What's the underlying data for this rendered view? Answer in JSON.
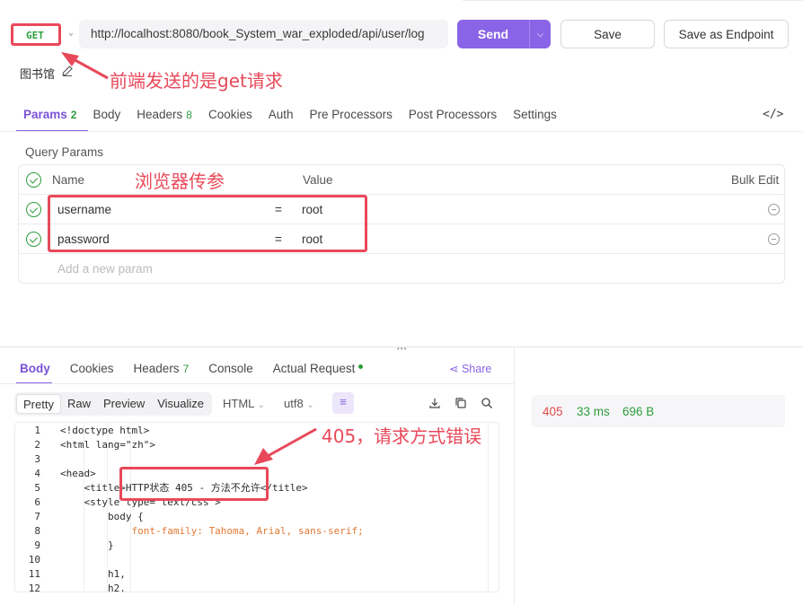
{
  "request": {
    "method": "GET",
    "url": "http://localhost:8080/book_System_war_exploded/api/user/log",
    "send_label": "Send",
    "save_label": "Save",
    "save_endpoint_label": "Save as Endpoint",
    "name": "图书馆"
  },
  "annotations": {
    "get_note": "前端发送的是get请求",
    "params_note": "浏览器传参",
    "error_note": "405，请求方式错误"
  },
  "request_tabs": [
    {
      "label": "Params",
      "count": "2"
    },
    {
      "label": "Body"
    },
    {
      "label": "Headers",
      "count": "8"
    },
    {
      "label": "Cookies"
    },
    {
      "label": "Auth"
    },
    {
      "label": "Pre Processors"
    },
    {
      "label": "Post Processors"
    },
    {
      "label": "Settings"
    }
  ],
  "query_params": {
    "title": "Query Params",
    "col_name": "Name",
    "col_value": "Value",
    "bulk_edit": "Bulk Edit",
    "rows": [
      {
        "name": "username",
        "eq": "=",
        "value": "root"
      },
      {
        "name": "password",
        "eq": "=",
        "value": "root"
      }
    ],
    "add_placeholder": "Add a new param"
  },
  "response_tabs": [
    {
      "label": "Body"
    },
    {
      "label": "Cookies"
    },
    {
      "label": "Headers",
      "count": "7"
    },
    {
      "label": "Console"
    },
    {
      "label": "Actual Request"
    }
  ],
  "share_label": "Share",
  "view_modes": [
    "Pretty",
    "Raw",
    "Preview",
    "Visualize"
  ],
  "format": {
    "type": "HTML",
    "encoding": "utf8"
  },
  "code_lines": [
    {
      "n": "1",
      "text": "<!doctype html>"
    },
    {
      "n": "2",
      "text": "<html lang=\"zh\">"
    },
    {
      "n": "3",
      "text": ""
    },
    {
      "n": "4",
      "text": "<head>"
    },
    {
      "n": "5",
      "text": "    <title>HTTP状态 405 - 方法不允许</title>"
    },
    {
      "n": "6",
      "text": "    <style type=\"text/css\">"
    },
    {
      "n": "7",
      "text": "        body {"
    },
    {
      "n": "8",
      "text": "            font-family: Tahoma, Arial, sans-serif;"
    },
    {
      "n": "9",
      "text": "        }"
    },
    {
      "n": "10",
      "text": ""
    },
    {
      "n": "11",
      "text": "        h1,"
    },
    {
      "n": "12",
      "text": "        h2,"
    }
  ],
  "response_status": {
    "code": "405",
    "time": "33 ms",
    "size": "696 B"
  },
  "colors": {
    "accent": "#8a64e6",
    "success": "#2e9d3c",
    "error": "#e04848",
    "annotation": "#e8495a"
  }
}
